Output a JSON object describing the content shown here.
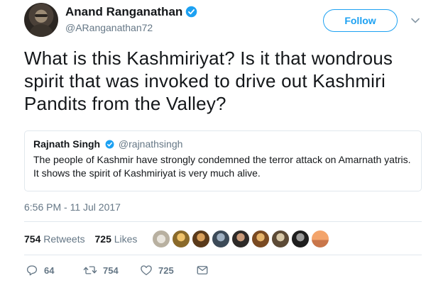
{
  "author": {
    "name": "Anand Ranganathan",
    "handle": "@ARanganathan72"
  },
  "follow_label": "Follow",
  "tweet_text": "What is this Kashmiriyat? Is it that wondrous spirit that was invoked to drive out Kashmiri Pandits from the Valley?",
  "quoted": {
    "name": "Rajnath Singh",
    "handle": "@rajnathsingh",
    "text": "The people of Kashmir have strongly condemned the terror attack on Amarnath yatris. It shows the spirit of Kashmiriyat is very much alive."
  },
  "timestamp": "6:56 PM - 11 Jul 2017",
  "stats": {
    "retweets_count": "754",
    "retweets_label": "Retweets",
    "likes_count": "725",
    "likes_label": "Likes"
  },
  "actions": {
    "reply_count": "64",
    "retweet_count": "754",
    "like_count": "725"
  },
  "colors": {
    "accent": "#1da1f2",
    "secondary_text": "#657786",
    "border": "#e1e8ed"
  },
  "icons": [
    "verified-badge-icon",
    "chevron-down-icon",
    "reply-icon",
    "retweet-icon",
    "heart-icon",
    "message-icon"
  ]
}
